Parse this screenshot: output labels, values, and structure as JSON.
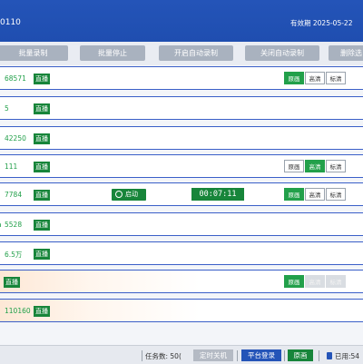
{
  "header": {
    "title": "0110",
    "expiry": "有效期 2025-05-22"
  },
  "toolbar": {
    "buttons": [
      "批量录制",
      "批量停止",
      "开启自动录制",
      "关闭自动录制",
      "删除选"
    ]
  },
  "rows": [
    {
      "id": "68571",
      "live": "直播",
      "quality": [
        "原画",
        "高清",
        "标清"
      ],
      "quality_state": [
        "on",
        "off",
        "off"
      ]
    },
    {
      "id": "5",
      "live": "直播"
    },
    {
      "id": "42250",
      "live": "直播"
    },
    {
      "id": "111",
      "live": "直播",
      "quality": [
        "原画",
        "高清",
        "标清"
      ],
      "quality_state": [
        "off",
        "on",
        "off"
      ]
    },
    {
      "id": "7784",
      "live": "直播",
      "status": "启动",
      "timer": "00:07:11",
      "quality": [
        "原画",
        "高清",
        "标清"
      ],
      "quality_state": [
        "on",
        "off",
        "off"
      ]
    },
    {
      "id": "5528",
      "prefix": "a",
      "live": "直播"
    },
    {
      "id": "6.5万",
      "live": "直播"
    },
    {
      "id": "",
      "live": "直播",
      "quality": [
        "原画",
        "高清",
        "标清"
      ],
      "quality_state": [
        "on",
        "dis",
        "dis"
      ]
    },
    {
      "id": "110160",
      "live": "直播"
    }
  ],
  "footer": {
    "task_count": "任务数: 50(",
    "timer_shutdown": "定时关机",
    "platform_login": "平台登录",
    "original": "原画",
    "used": "已用:54"
  },
  "colors": {
    "header": "#2454b8",
    "accent_green": "#17853a",
    "row_border": "#3a5fc8",
    "button_gray": "#a9b2bf"
  }
}
